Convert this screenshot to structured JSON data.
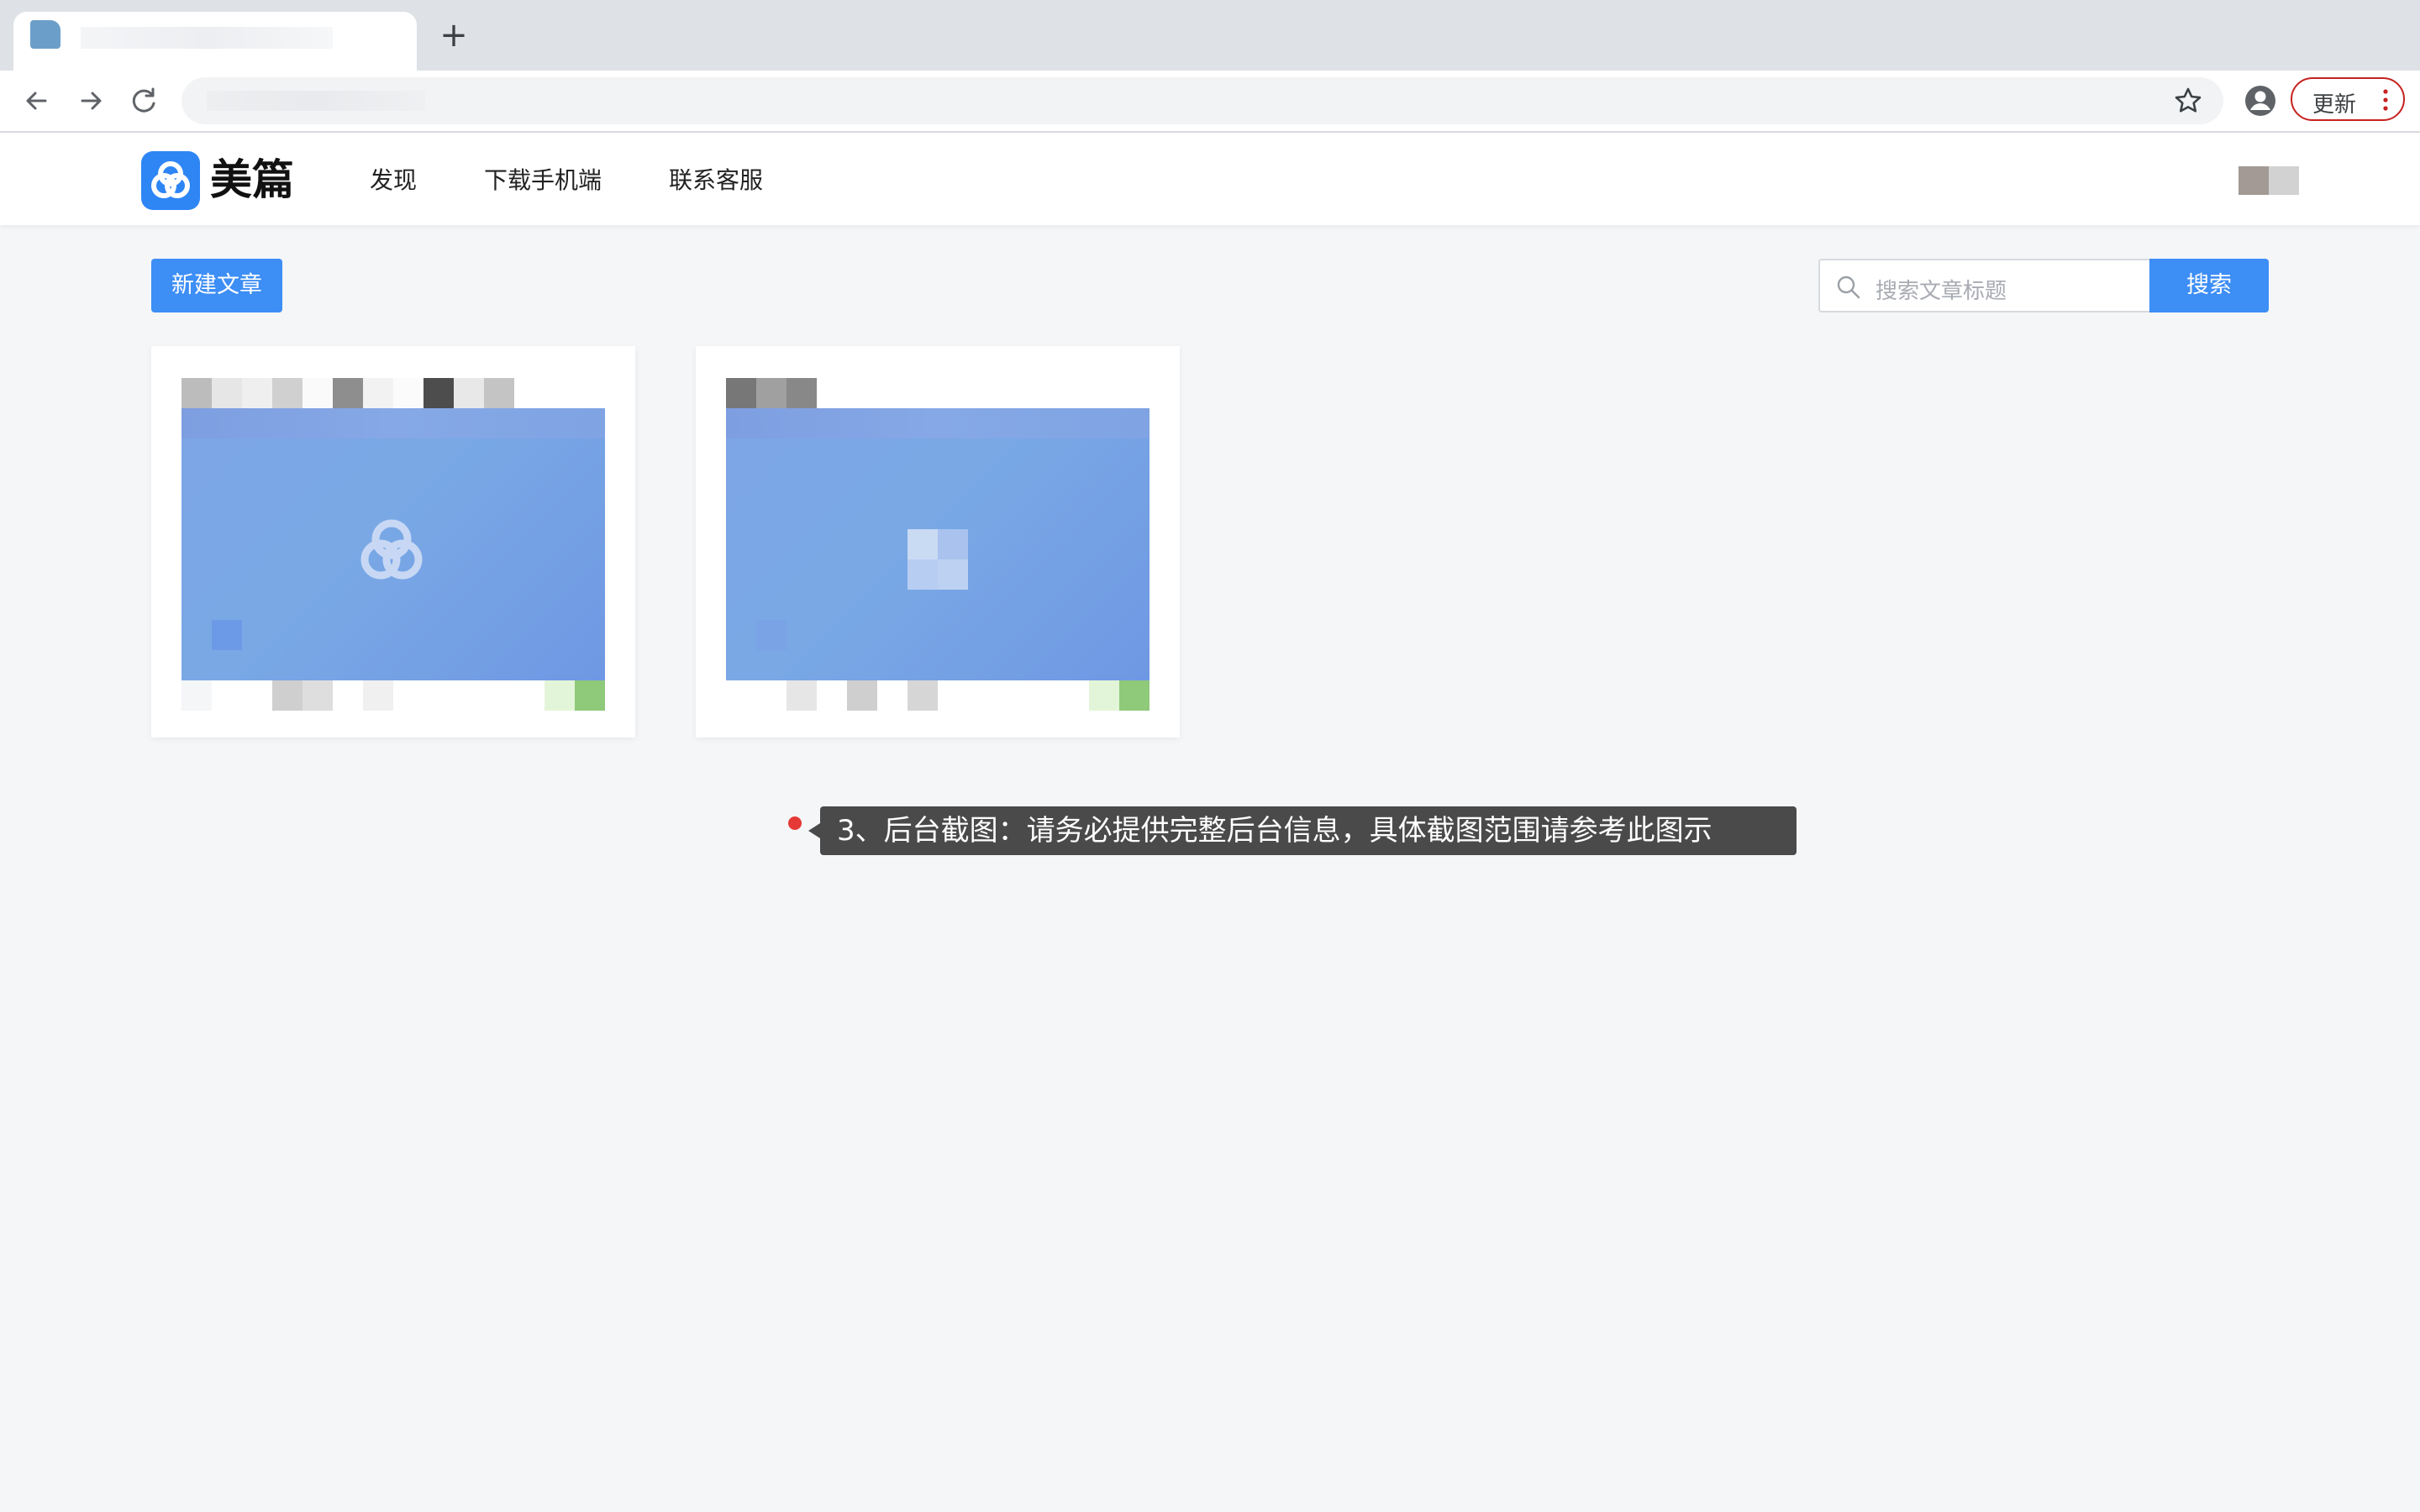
{
  "browser": {
    "new_tab_symbol": "+",
    "update_label": "更新"
  },
  "header": {
    "brand": "美篇",
    "nav": [
      "发现",
      "下载手机端",
      "联系客服"
    ]
  },
  "toolbar": {
    "new_article_label": "新建文章",
    "search_placeholder": "搜索文章标题",
    "search_button_label": "搜索"
  },
  "annotation": {
    "text": "3、后台截图：请务必提供完整后台信息，具体截图范围请参考此图示",
    "dot_color": "#e53935"
  },
  "colors": {
    "accent": "#3d8ef5",
    "logo": "#2e86f5"
  }
}
